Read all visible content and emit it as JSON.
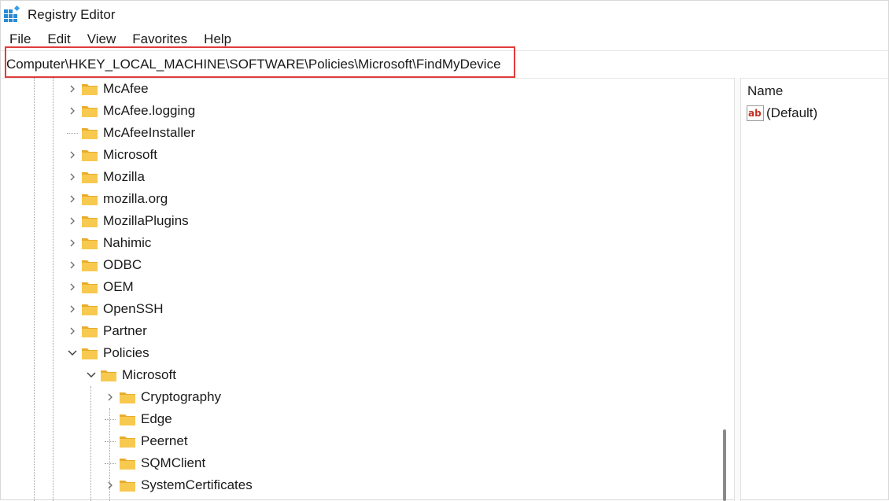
{
  "window": {
    "title": "Registry Editor"
  },
  "menu": [
    "File",
    "Edit",
    "View",
    "Favorites",
    "Help"
  ],
  "address": "Computer\\HKEY_LOCAL_MACHINE\\SOFTWARE\\Policies\\Microsoft\\FindMyDevice",
  "tree": [
    {
      "label": "McAfee",
      "chevron": "right"
    },
    {
      "label": "McAfee.logging",
      "chevron": "right"
    },
    {
      "label": "McAfeeInstaller",
      "chevron": "none"
    },
    {
      "label": "Microsoft",
      "chevron": "right"
    },
    {
      "label": "Mozilla",
      "chevron": "right"
    },
    {
      "label": "mozilla.org",
      "chevron": "right"
    },
    {
      "label": "MozillaPlugins",
      "chevron": "right"
    },
    {
      "label": "Nahimic",
      "chevron": "right"
    },
    {
      "label": "ODBC",
      "chevron": "right"
    },
    {
      "label": "OEM",
      "chevron": "right"
    },
    {
      "label": "OpenSSH",
      "chevron": "right"
    },
    {
      "label": "Partner",
      "chevron": "right"
    },
    {
      "label": "Policies",
      "chevron": "down"
    },
    {
      "label": "Microsoft",
      "chevron": "down"
    },
    {
      "label": "Cryptography",
      "chevron": "right"
    },
    {
      "label": "Edge",
      "chevron": "none"
    },
    {
      "label": "Peernet",
      "chevron": "none"
    },
    {
      "label": "SQMClient",
      "chevron": "none"
    },
    {
      "label": "SystemCertificates",
      "chevron": "right"
    }
  ],
  "values": {
    "column_name": "Name",
    "rows": [
      {
        "name": "(Default)",
        "icon": "string-value-icon"
      }
    ]
  },
  "colors": {
    "folder": "#f4c04a",
    "highlight": "#e03c3c"
  }
}
